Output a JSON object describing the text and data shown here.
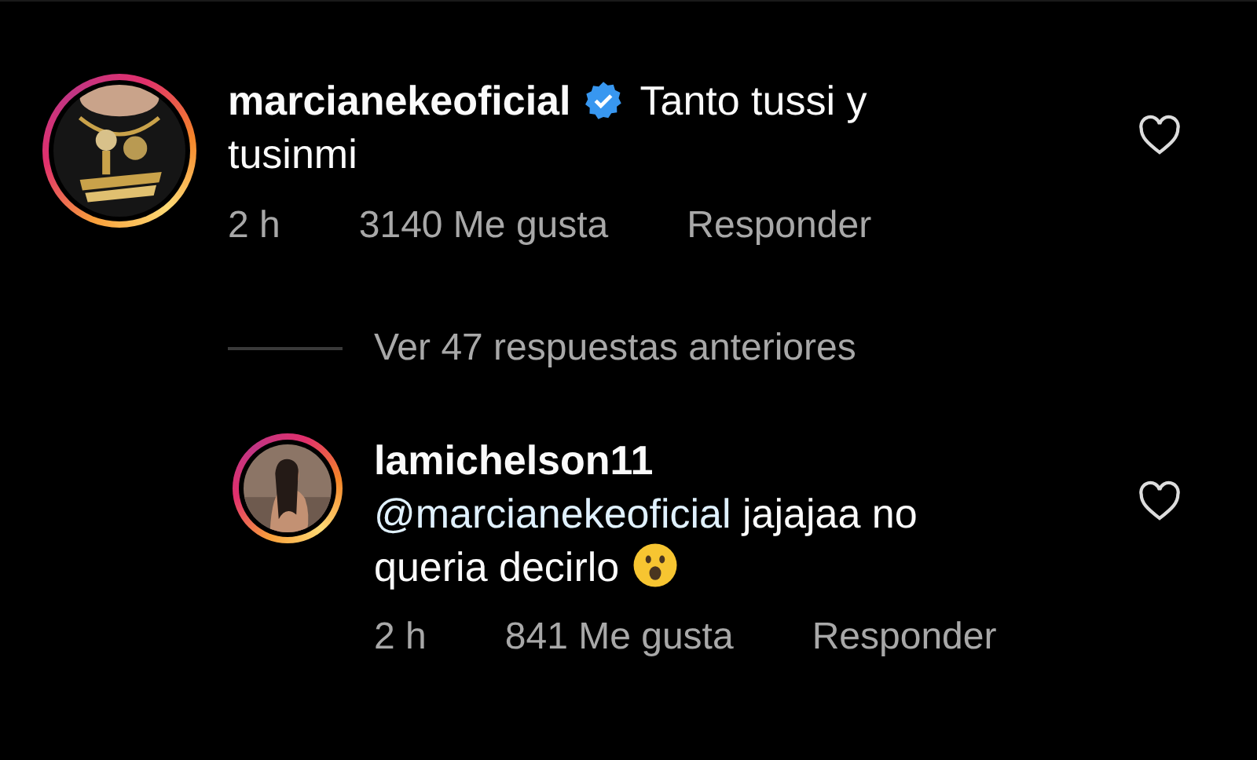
{
  "comment": {
    "username": "marcianekeoficial",
    "verified": true,
    "text": "Tanto tussi y tusinmi",
    "time": "2 h",
    "likes": "3140 Me gusta",
    "reply_label": "Responder",
    "liked": false
  },
  "view_replies": "Ver 47 respuestas anteriores",
  "reply": {
    "username": "lamichelson11",
    "mention": "@marcianekeoficial",
    "text": "jajajaa no queria decirlo",
    "emoji": true,
    "time": "2 h",
    "likes": "841 Me gusta",
    "reply_label": "Responder",
    "liked": false
  }
}
